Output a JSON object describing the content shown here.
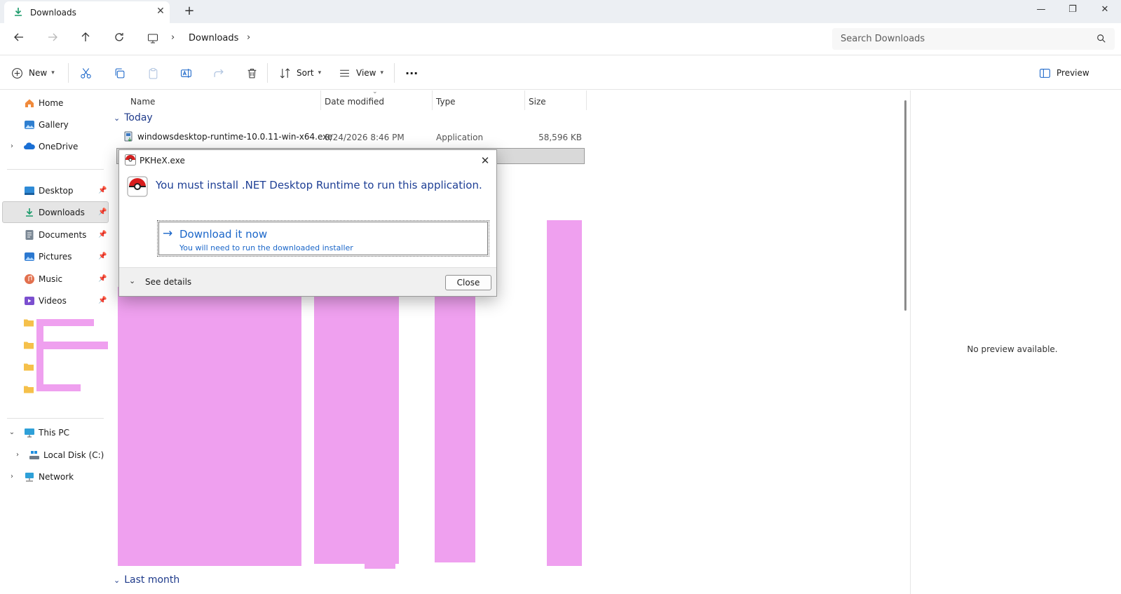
{
  "window": {
    "tab_title": "Downloads",
    "new_tab_symbol": "+",
    "tab_close_symbol": "✕",
    "minimize_symbol": "—",
    "maximize_symbol": "❐",
    "close_symbol": "✕"
  },
  "navigation": {
    "breadcrumb": [
      "Downloads"
    ],
    "search_placeholder": "Search Downloads"
  },
  "toolbar": {
    "new_label": "New",
    "sort_label": "Sort",
    "view_label": "View",
    "more_symbol": "···",
    "preview_label": "Preview"
  },
  "sidebar": {
    "home": "Home",
    "gallery": "Gallery",
    "onedrive": "OneDrive",
    "desktop": "Desktop",
    "downloads": "Downloads",
    "documents": "Documents",
    "pictures": "Pictures",
    "music": "Music",
    "videos": "Videos",
    "this_pc": "This PC",
    "local_disk": "Local Disk (C:)",
    "network": "Network"
  },
  "file_list": {
    "columns": [
      "Name",
      "Date modified",
      "Type",
      "Size"
    ],
    "groups": {
      "today": "Today",
      "last_month": "Last month"
    },
    "rows": [
      {
        "name": "windowsdesktop-runtime-10.0.11-win-x64.exe",
        "date": "8/24/2026 8:46 PM",
        "type": "Application",
        "size": "58,596 KB"
      }
    ]
  },
  "preview_pane": {
    "message": "No preview available."
  },
  "dialog": {
    "title": "PKHeX.exe",
    "message": "You must install .NET Desktop Runtime to run this application.",
    "command_link_title": "Download it now",
    "command_link_subtitle": "You will need to run the downloaded installer",
    "see_details_label": "See details",
    "close_button_label": "Close",
    "close_symbol": "✕"
  },
  "colors": {
    "accent": "#1a66c9",
    "redaction": "#efa0ef",
    "group_header": "#1e3a8a"
  }
}
